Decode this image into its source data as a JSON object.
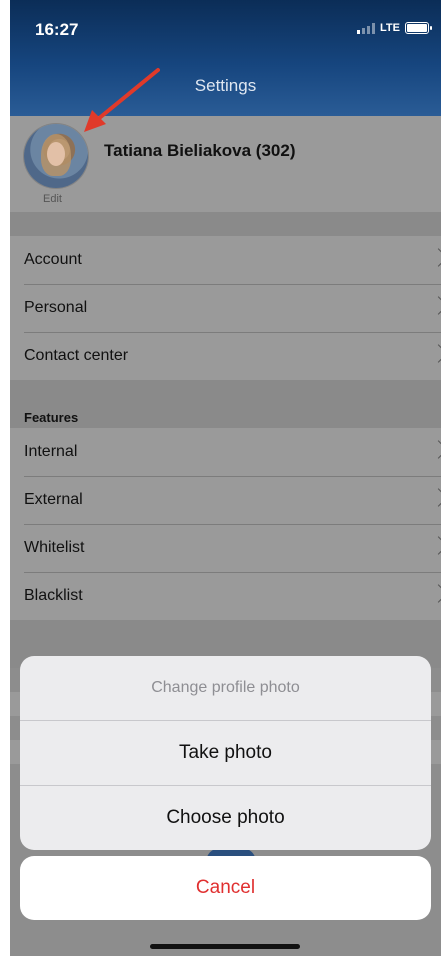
{
  "status_bar": {
    "time": "16:27",
    "network": "LTE"
  },
  "header": {
    "title": "Settings"
  },
  "profile": {
    "name": "Tatiana Bieliakova (302)",
    "edit_label": "Edit"
  },
  "menu_group_1": {
    "items": [
      {
        "label": "Account"
      },
      {
        "label": "Personal"
      },
      {
        "label": "Contact center"
      }
    ]
  },
  "features": {
    "header": "Features",
    "items": [
      {
        "label": "Internal"
      },
      {
        "label": "External"
      },
      {
        "label": "Whitelist"
      },
      {
        "label": "Blacklist"
      }
    ]
  },
  "action_sheet": {
    "title": "Change profile photo",
    "take_photo": "Take photo",
    "choose_photo": "Choose photo",
    "cancel": "Cancel"
  },
  "colors": {
    "header_dark": "#0b2d57",
    "cancel_red": "#e03030",
    "annotation_arrow": "#e03a2a"
  }
}
